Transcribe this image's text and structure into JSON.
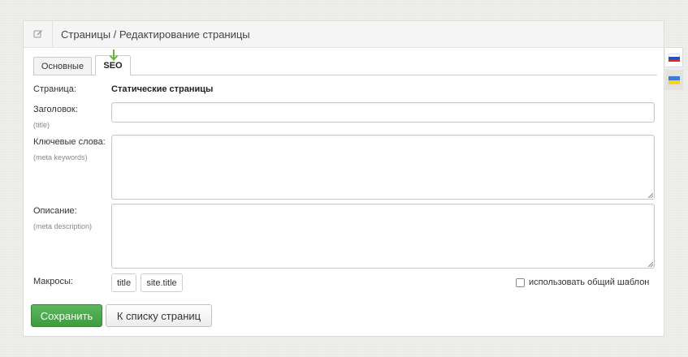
{
  "header": {
    "title": "Страницы / Редактирование страницы",
    "icon": "edit-icon"
  },
  "tabs": [
    {
      "label": "Основные",
      "active": false
    },
    {
      "label": "SEO",
      "active": true
    }
  ],
  "form": {
    "page": {
      "label": "Страница:",
      "value": "Статические страницы"
    },
    "title": {
      "label": "Заголовок:",
      "hint": "(title)",
      "value": ""
    },
    "keywords": {
      "label": "Ключевые слова:",
      "hint": "(meta keywords)",
      "value": ""
    },
    "description": {
      "label": "Описание:",
      "hint": "(meta description)",
      "value": ""
    },
    "macros": {
      "label": "Макросы:",
      "items": [
        "title",
        "site.title"
      ]
    },
    "use_template": {
      "label": "использовать общий шаблон",
      "checked": false
    }
  },
  "buttons": {
    "save": "Сохранить",
    "back_to_list": "К списку страниц"
  },
  "languages": [
    {
      "code": "ru",
      "flag_colors": [
        "#ffffff",
        "#2b4fb5",
        "#d52b1e"
      ],
      "active": true
    },
    {
      "code": "ua",
      "flag_colors": [
        "#3b7bd6",
        "#f7d417"
      ],
      "active": false
    }
  ],
  "colors": {
    "save_button": "#4cae4c",
    "annotation_arrow": "#5cb82e"
  }
}
